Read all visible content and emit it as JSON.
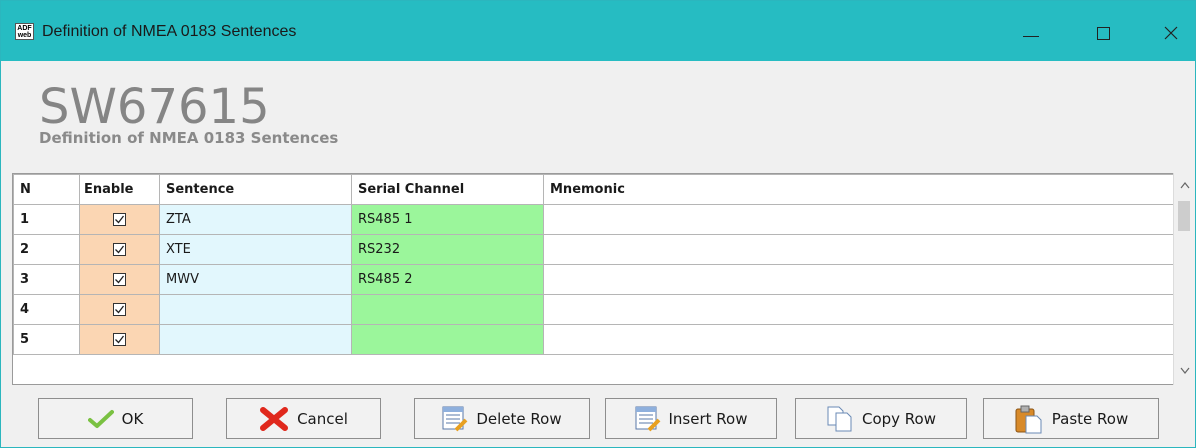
{
  "window": {
    "app_icon_text": "ADF\nweb",
    "title": "Definition of NMEA 0183 Sentences"
  },
  "header": {
    "big_title": "SW67615",
    "subtitle": "Definition of NMEA 0183 Sentences"
  },
  "table": {
    "columns": [
      "N",
      "Enable",
      "Sentence",
      "Serial Channel",
      "Mnemonic"
    ],
    "rows": [
      {
        "n": "1",
        "enabled": true,
        "sentence": "ZTA",
        "serial_channel": "RS485 1",
        "mnemonic": ""
      },
      {
        "n": "2",
        "enabled": true,
        "sentence": "XTE",
        "serial_channel": "RS232",
        "mnemonic": ""
      },
      {
        "n": "3",
        "enabled": true,
        "sentence": "MWV",
        "serial_channel": "RS485 2",
        "mnemonic": ""
      },
      {
        "n": "4",
        "enabled": true,
        "sentence": "",
        "serial_channel": "",
        "mnemonic": ""
      },
      {
        "n": "5",
        "enabled": true,
        "sentence": "",
        "serial_channel": "",
        "mnemonic": ""
      }
    ]
  },
  "buttons": {
    "ok": "OK",
    "cancel": "Cancel",
    "delete_row": "Delete Row",
    "insert_row": "Insert Row",
    "copy_row": "Copy Row",
    "paste_row": "Paste Row"
  },
  "colors": {
    "titlebar": "#26bcc2",
    "enable_cell": "#fbd6b3",
    "sentence_cell": "#e2f7fd",
    "serial_cell": "#9bf69b"
  },
  "icons": {
    "ok": "checkmark-icon",
    "cancel": "red-x-icon",
    "delete_row": "table-delete-icon",
    "insert_row": "table-insert-icon",
    "copy_row": "copy-pages-icon",
    "paste_row": "clipboard-paste-icon"
  }
}
